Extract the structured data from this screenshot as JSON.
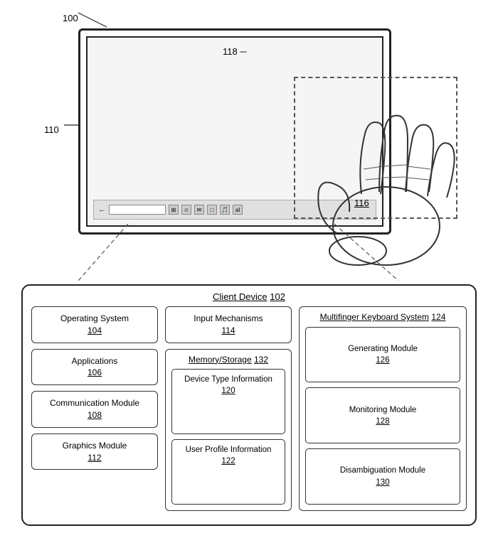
{
  "labels": {
    "fig_number": "100",
    "monitor_label": "110",
    "region_label": "118",
    "hand_label": "116",
    "client_device_title": "Client Device",
    "client_device_num": "102",
    "os_label": "Operating System",
    "os_num": "104",
    "apps_label": "Applications",
    "apps_num": "106",
    "comm_label": "Communication Module",
    "comm_num": "108",
    "graphics_label": "Graphics Module",
    "graphics_num": "112",
    "input_label": "Input Mechanisms",
    "input_num": "114",
    "memory_label": "Memory/Storage",
    "memory_num": "132",
    "device_type_label": "Device Type Information",
    "device_type_num": "120",
    "user_profile_label": "User Profile Information",
    "user_profile_num": "122",
    "multifinger_label": "Multifinger Keyboard System",
    "multifinger_num": "124",
    "generating_label": "Generating Module",
    "generating_num": "126",
    "monitoring_label": "Monitoring Module",
    "monitoring_num": "128",
    "disambiguation_label": "Disambiguation Module",
    "disambiguation_num": "130"
  }
}
